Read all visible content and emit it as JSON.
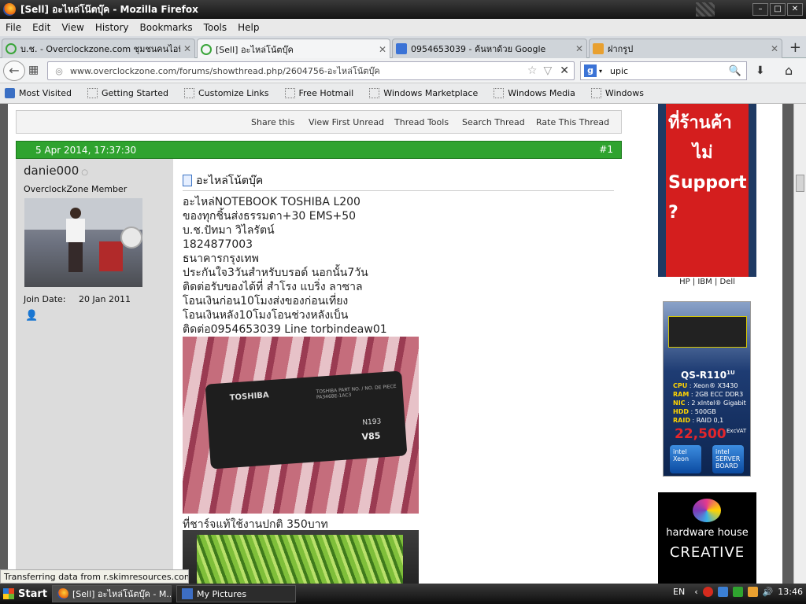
{
  "window": {
    "title": "[Sell] อะไหล่โน๊ตบุ๊ค - Mozilla Firefox"
  },
  "menu": [
    "File",
    "Edit",
    "View",
    "History",
    "Bookmarks",
    "Tools",
    "Help"
  ],
  "tabs": [
    {
      "label": "บ.ช. - Overclockzone.com ชุมชนคนไอที ..."
    },
    {
      "label": "[Sell] อะไหล่โน้ตบุ๊ค"
    },
    {
      "label": "0954653039 - ค้นหาด้วย Google"
    },
    {
      "label": "ฝากรูป"
    }
  ],
  "nav": {
    "url": "www.overclockzone.com/forums/showthread.php/2604756-อะไหล่โน้ตบุ๊ค",
    "search_query": "upic"
  },
  "bookmarks": [
    "Most Visited",
    "Getting Started",
    "Customize Links",
    "Free Hotmail",
    "Windows Marketplace",
    "Windows Media",
    "Windows"
  ],
  "toolbar": [
    "Share this",
    "View First Unread",
    "Thread Tools",
    "Search Thread",
    "Rate This Thread"
  ],
  "post": {
    "date": "5 Apr 2014, 17:37:30",
    "number": "#1",
    "user": "danie000",
    "user_title": "OverclockZone Member",
    "join_label": "Join Date:",
    "join_value": "20 Jan 2011",
    "title": "อะไหล่โน้ตบุ๊ค",
    "lines": [
      "อะไหล่NOTEBOOK TOSHIBA L200",
      "ของทุกชิ้นส่งธรรมดา+30 EMS+50",
      "บ.ช.ปัทมา วิไลรัตน์",
      "1824877003",
      "ธนาคารกรุงเทพ",
      "ประกันใจ3วันสำหรับบรอด์ นอกนั้น7วัน",
      "ติดต่อรับของได้ที่ สำโรง แบริ่ง ลาซาล",
      "โอนเงินก่อน10โมงส่งของก่อนเที่ยง",
      "โอนเงินหลัง10โมงโอนช่วงหลังเบ็น",
      "ติดต่อ0954653039 Line torbindeaw01"
    ],
    "photo1_text": {
      "brand": "TOSHIBA",
      "label": "TOSHIBA PART NO. / NO. DE PIECE PA3468E-1AC3",
      "model": "V85",
      "code": "N193"
    },
    "caption2": "ที่ชาร์จแท้ใช้งานปกติ 350บาท"
  },
  "ads": {
    "ad1_lines": [
      "ที่ร้านค้า",
      "ไม่",
      "Support",
      "?"
    ],
    "ad1_caption": "HP | IBM | Dell",
    "ad2": {
      "model": "QS-R110",
      "model_sup": "1U",
      "specs": [
        [
          "CPU",
          "Xeon® X3430"
        ],
        [
          "RAM",
          "2GB ECC DDR3"
        ],
        [
          "NIC",
          "2 xIntel® Gigabit"
        ],
        [
          "HDD",
          "500GB"
        ],
        [
          "RAID",
          "RAID 0,1"
        ]
      ],
      "price": "22,500",
      "vat": "ExcVAT",
      "chip1": "intel Xeon",
      "chip2": "intel SERVER BOARD"
    },
    "ad3": {
      "line1": "hardware house",
      "line2": "CREATIVE"
    }
  },
  "status": "Transferring data from r.skimresources.com...",
  "taskbar": {
    "start": "Start",
    "tasks": [
      "[Sell] อะไหล่โน้ตบุ๊ค - M...",
      "My Pictures"
    ],
    "lang": "EN",
    "time": "13:46"
  }
}
